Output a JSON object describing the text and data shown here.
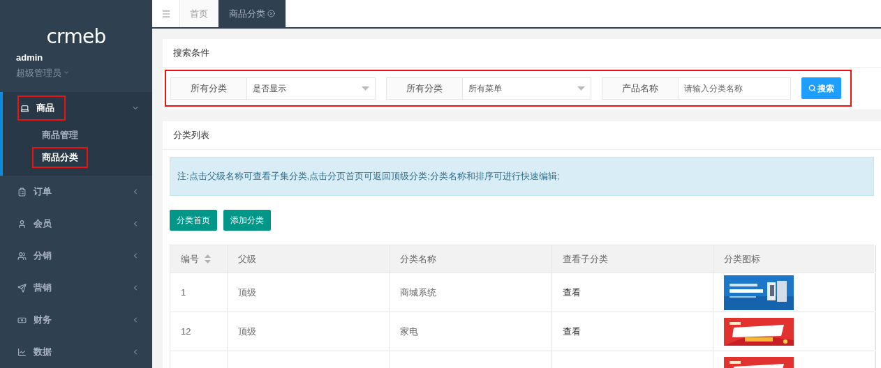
{
  "logo": {
    "text": "crmeb"
  },
  "user": {
    "name": "admin",
    "role": "超级管理员"
  },
  "sidebar": {
    "items": [
      {
        "label": "商品",
        "expanded": true,
        "highlighted": true,
        "children": [
          {
            "label": "商品管理",
            "selected": false,
            "highlighted": false
          },
          {
            "label": "商品分类",
            "selected": true,
            "highlighted": true
          }
        ]
      },
      {
        "label": "订单",
        "expanded": false,
        "highlighted": false
      },
      {
        "label": "会员",
        "expanded": false,
        "highlighted": false
      },
      {
        "label": "分销",
        "expanded": false,
        "highlighted": false
      },
      {
        "label": "营销",
        "expanded": false,
        "highlighted": false
      },
      {
        "label": "财务",
        "expanded": false,
        "highlighted": false
      },
      {
        "label": "数据",
        "expanded": false,
        "highlighted": false
      }
    ]
  },
  "tabs": [
    {
      "label": "首页",
      "selected": false,
      "closable": false
    },
    {
      "label": "商品分类",
      "selected": true,
      "closable": true
    }
  ],
  "search_panel": {
    "title": "搜索条件",
    "highlighted": true,
    "filters": [
      {
        "kind": "select",
        "label": "所有分类",
        "value": "是否显示"
      },
      {
        "kind": "select",
        "label": "所有分类",
        "value": "所有菜单"
      },
      {
        "kind": "input",
        "label": "产品名称",
        "placeholder": "请输入分类名称"
      }
    ],
    "button": "搜索"
  },
  "list_panel": {
    "title": "分类列表",
    "notice": "注:点击父级名称可查看子集分类,点击分页首页可返回顶级分类;分类名称和排序可进行快速编辑;",
    "buttons": [
      "分类首页",
      "添加分类"
    ],
    "table": {
      "columns": [
        "编号",
        "父级",
        "分类名称",
        "查看子分类",
        "分类图标"
      ],
      "rows": [
        {
          "id": "1",
          "parent": "顶级",
          "name": "商城系统",
          "view": "查看",
          "icon": {
            "kind": "picture"
          }
        },
        {
          "id": "12",
          "parent": "顶级",
          "name": "家电",
          "view": "查看",
          "icon": {
            "kind": "picture"
          }
        },
        {
          "icon": {
            "kind": "picture"
          }
        }
      ]
    }
  }
}
